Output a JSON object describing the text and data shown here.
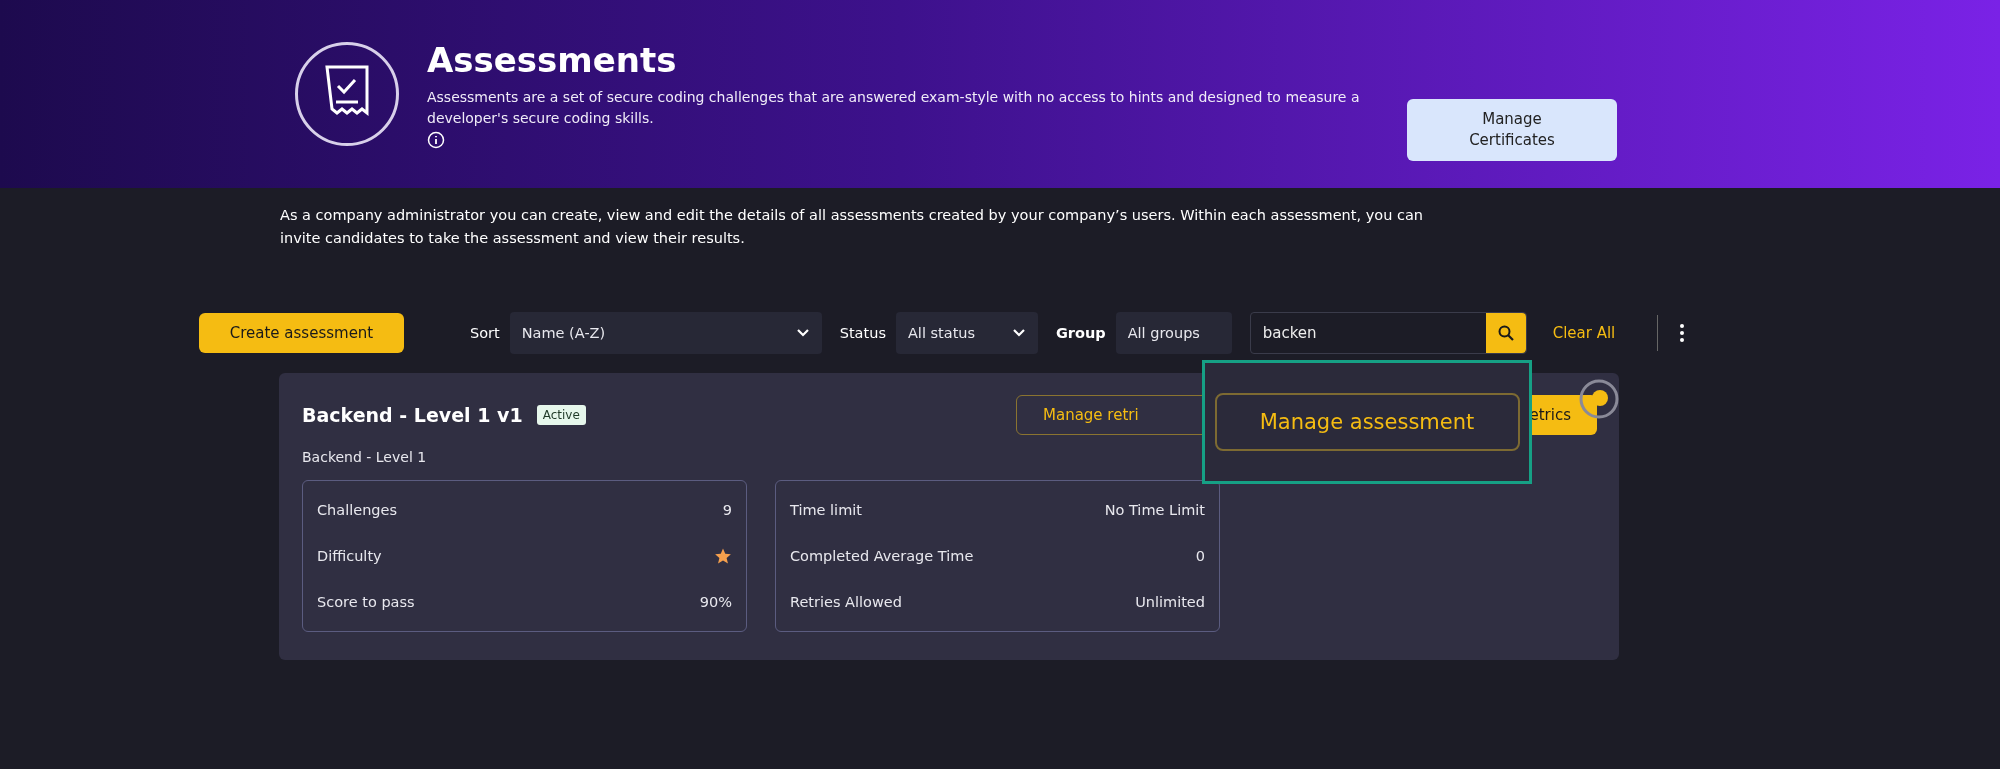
{
  "header": {
    "title": "Assessments",
    "description": "Assessments are a set of secure coding challenges that are answered exam-style with no access to hints and designed to measure a developer's secure coding skills.",
    "certificates_button": "Manage Certificates"
  },
  "intro": "As a company administrator you can create, view and edit the details of all assessments created by your company’s users. Within each assessment, you can invite candidates to take the assessment and view their results.",
  "toolbar": {
    "create_button": "Create assessment",
    "sort": {
      "label": "Sort",
      "value": "Name (A-Z)"
    },
    "status": {
      "label": "Status",
      "value": "All status"
    },
    "group": {
      "label": "Group",
      "value": "All groups"
    },
    "search": {
      "value": "backen"
    },
    "clear_button": "Clear All"
  },
  "card": {
    "title": "Backend - Level 1 v1",
    "badge": "Active",
    "subtitle": "Backend - Level 1",
    "buttons": [
      "Manage retri",
      "etrics"
    ],
    "stats_left": [
      {
        "kind": "text",
        "label": "Challenges",
        "value": "9"
      },
      {
        "kind": "star",
        "label": "Difficulty"
      },
      {
        "kind": "text",
        "label": "Score to pass",
        "value": "90%"
      }
    ],
    "stats_right": [
      {
        "kind": "text",
        "label": "Time limit",
        "value": "No Time Limit"
      },
      {
        "kind": "text",
        "label": "Completed Average Time",
        "value": "0"
      },
      {
        "kind": "text",
        "label": "Retries Allowed",
        "value": "Unlimited"
      }
    ]
  },
  "tour": {
    "button": "Manage assessment"
  }
}
